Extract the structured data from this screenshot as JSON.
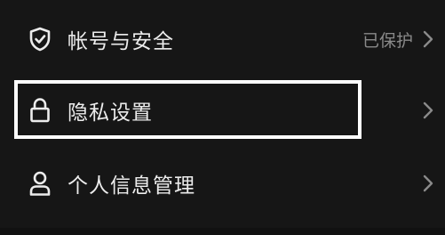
{
  "settings": {
    "items": [
      {
        "label": "帐号与安全",
        "status": "已保护",
        "icon": "shield-check-icon"
      },
      {
        "label": "隐私设置",
        "status": "",
        "icon": "lock-icon",
        "highlighted": true
      },
      {
        "label": "个人信息管理",
        "status": "",
        "icon": "person-icon"
      }
    ]
  },
  "colors": {
    "background": "#161616",
    "label_text": "#ececec",
    "status_text": "#8a8a8a",
    "chevron": "#8a8a8a",
    "highlight_border": "#ffffff"
  }
}
